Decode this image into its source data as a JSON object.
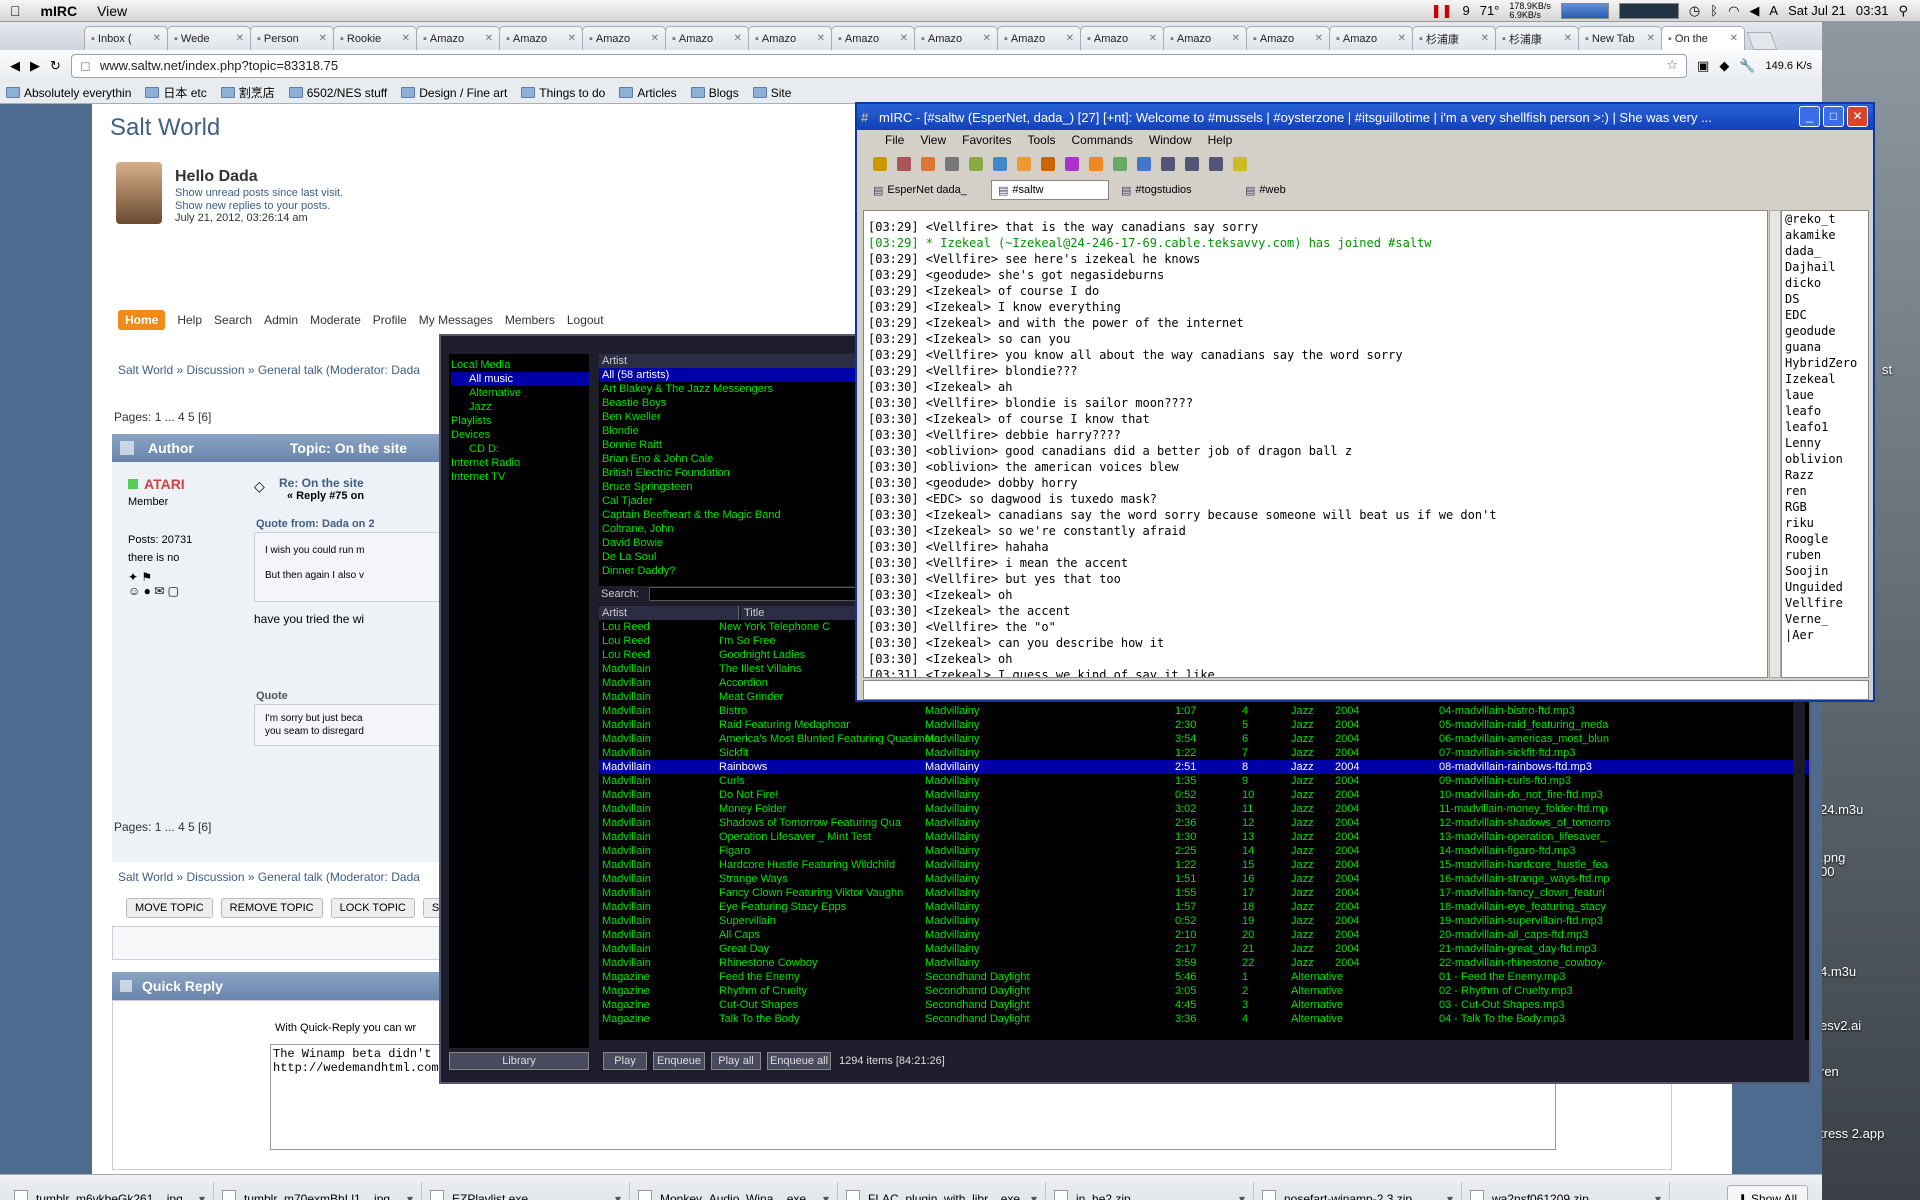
{
  "menubar": {
    "app": "mIRC",
    "menu": "View",
    "temp": "9",
    "pct": "71°",
    "net_up": "178.9KB/s",
    "net_down": "6.9KB/s",
    "date": "Sat Jul 21",
    "time": "03:31"
  },
  "browser": {
    "tabs": [
      "Inbox (",
      "Wede",
      "Person",
      "Rookie",
      "Amazo",
      "Amazo",
      "Amazo",
      "Amazo",
      "Amazo",
      "Amazo",
      "Amazo",
      "Amazo",
      "Amazo",
      "Amazo",
      "Amazo",
      "Amazo",
      "杉浦康",
      "杉浦康",
      "New Tab",
      "On the"
    ],
    "url": "www.saltw.net/index.php?topic=83318.75",
    "speed": "149.6 K/s",
    "bookmarks": [
      "Absolutely everythin",
      "日本 etc",
      "割烹店",
      "6502/NES stuff",
      "Design / Fine art",
      "Things to do",
      "Articles",
      "Blogs",
      "Site"
    ]
  },
  "forum": {
    "title": "Salt World",
    "hello": "Hello Dada",
    "unread": "Show unread posts since last visit.",
    "replies": "Show new replies to your posts.",
    "last_visit": "July 21, 2012, 03:26:14 am",
    "nav": [
      "Home",
      "Help",
      "Search",
      "Admin",
      "Moderate",
      "Profile",
      "My Messages",
      "Members",
      "Logout"
    ],
    "breadcrumb": "Salt World » Discussion » General talk (Moderator: Dada",
    "pages": "Pages: 1 ... 4 5 [6]",
    "author_hdr": "Author",
    "topic_hdr": "Topic: On the site",
    "poster": "ATARI",
    "member": "Member",
    "posts": "Posts: 20731",
    "sig": "there is no",
    "post_title": "Re: On the site",
    "reply_no": "« Reply #75 on",
    "quote_from": "Quote from: Dada on 2",
    "quote1a": "I wish you could run m",
    "quote1b": "But then again I also v",
    "body1": "have you tried the wi",
    "quote_label": "Quote",
    "quote2a": "I'm sorry but just beca",
    "quote2b": "you seam to disregard",
    "pages2": "Pages: 1 ... 4 5 [6]",
    "breadcrumb2": "Salt World » Discussion » General talk (Moderator: Dada",
    "actions": [
      "MOVE TOPIC",
      "REMOVE TOPIC",
      "LOCK TOPIC",
      "SE"
    ],
    "quick_reply": "Quick Reply",
    "qr_note": "With Quick-Reply you can wr",
    "reply_line1": "The Winamp beta didn't rea",
    "reply_line2": "http://wedemandhtml.com/"
  },
  "winamp": {
    "tree": [
      "Local Media",
      "All music",
      "Alternative",
      "Jazz",
      "Playlists",
      "Devices",
      "CD D:",
      "Internet Radio",
      "Internet TV"
    ],
    "artist_hdr": "Artist",
    "artists": [
      "All (58 artists)",
      "Art Blakey & The Jazz Messengers",
      "Beastie Boys",
      "Ben Kweller",
      "Blondie",
      "Bonnie Raitt",
      "Brian Eno & John Cale",
      "British Electric Foundation",
      "Bruce Springsteen",
      "Cal Tjader",
      "Captain Beefheart & the Magic Band",
      "Coltrane, John",
      "David Bowie",
      "De La Soul",
      "Dinner Daddy?"
    ],
    "search_label": "Search:",
    "col_artist": "Artist",
    "col_title": "Title",
    "tracks": [
      [
        "Lou Reed",
        "New York Telephone C",
        "",
        "",
        "",
        "",
        "",
        ""
      ],
      [
        "Lou Reed",
        "I'm So Free",
        "",
        "",
        "",
        "",
        "",
        ""
      ],
      [
        "Lou Reed",
        "Goodnight Ladies",
        "",
        "",
        "",
        "",
        "",
        ""
      ],
      [
        "Madvillain",
        "The Illest Villains",
        "",
        "",
        "",
        "",
        "",
        ""
      ],
      [
        "Madvillain",
        "Accordion",
        "",
        "",
        "",
        "",
        "",
        ""
      ],
      [
        "Madvillain",
        "Meat Grinder",
        "",
        "",
        "",
        "",
        "",
        ""
      ],
      [
        "Madvillain",
        "Bistro",
        "Madvillainy",
        "1:07",
        "4",
        "Jazz",
        "2004",
        "04-madvillain-bistro-ftd.mp3"
      ],
      [
        "Madvillain",
        "Raid Featuring Medaphoar",
        "Madvillainy",
        "2:30",
        "5",
        "Jazz",
        "2004",
        "05-madvillain-raid_featuring_meda"
      ],
      [
        "Madvillain",
        "America's Most Blunted Featuring Quasimoto",
        "Madvillainy",
        "3:54",
        "6",
        "Jazz",
        "2004",
        "06-madvillain-americas_most_blun"
      ],
      [
        "Madvillain",
        "Sickfit",
        "Madvillainy",
        "1:22",
        "7",
        "Jazz",
        "2004",
        "07-madvillain-sickfit-ftd.mp3"
      ],
      [
        "Madvillain",
        "Rainbows",
        "Madvillainy",
        "2:51",
        "8",
        "Jazz",
        "2004",
        "08-madvillain-rainbows-ftd.mp3"
      ],
      [
        "Madvillain",
        "Curls",
        "Madvillainy",
        "1:35",
        "9",
        "Jazz",
        "2004",
        "09-madvillain-curls-ftd.mp3"
      ],
      [
        "Madvillain",
        "Do Not Fire!",
        "Madvillainy",
        "0:52",
        "10",
        "Jazz",
        "2004",
        "10-madvillain-do_not_fire-ftd.mp3"
      ],
      [
        "Madvillain",
        "Money Folder",
        "Madvillainy",
        "3:02",
        "11",
        "Jazz",
        "2004",
        "11-madvillain-money_folder-ftd.mp"
      ],
      [
        "Madvillain",
        "Shadows of Tomorrow Featuring Qua",
        "Madvillainy",
        "2:36",
        "12",
        "Jazz",
        "2004",
        "12-madvillain-shadows_of_tomorro"
      ],
      [
        "Madvillain",
        "Operation Lifesaver _ Mint Test",
        "Madvillainy",
        "1:30",
        "13",
        "Jazz",
        "2004",
        "13-madvillain-operation_lifesaver_"
      ],
      [
        "Madvillain",
        "Figaro",
        "Madvillainy",
        "2:25",
        "14",
        "Jazz",
        "2004",
        "14-madvillain-figaro-ftd.mp3"
      ],
      [
        "Madvillain",
        "Hardcore Hustle Featuring Wildchild",
        "Madvillainy",
        "1:22",
        "15",
        "Jazz",
        "2004",
        "15-madvillain-hardcore_hustle_fea"
      ],
      [
        "Madvillain",
        "Strange Ways",
        "Madvillainy",
        "1:51",
        "16",
        "Jazz",
        "2004",
        "16-madvillain-strange_ways-ftd.mp"
      ],
      [
        "Madvillain",
        "Fancy Clown Featuring Viktor Vaughn",
        "Madvillainy",
        "1:55",
        "17",
        "Jazz",
        "2004",
        "17-madvillain-fancy_clown_featuri"
      ],
      [
        "Madvillain",
        "Eye Featuring Stacy Epps",
        "Madvillainy",
        "1:57",
        "18",
        "Jazz",
        "2004",
        "18-madvillain-eye_featuring_stacy"
      ],
      [
        "Madvillain",
        "Supervillain",
        "Madvillainy",
        "0:52",
        "19",
        "Jazz",
        "2004",
        "19-madvillain-supervillain-ftd.mp3"
      ],
      [
        "Madvillain",
        "All Caps",
        "Madvillainy",
        "2:10",
        "20",
        "Jazz",
        "2004",
        "20-madvillain-all_caps-ftd.mp3"
      ],
      [
        "Madvillain",
        "Great Day",
        "Madvillainy",
        "2:17",
        "21",
        "Jazz",
        "2004",
        "21-madvillain-great_day-ftd.mp3"
      ],
      [
        "Madvillain",
        "Rhinestone Cowboy",
        "Madvillainy",
        "3:59",
        "22",
        "Jazz",
        "2004",
        "22-madvillain-rhinestone_cowboy-"
      ],
      [
        "Magazine",
        "Feed the Enemy",
        "Secondhand Daylight",
        "5:46",
        "1",
        "Alternative",
        "",
        "01 - Feed the Enemy.mp3"
      ],
      [
        "Magazine",
        "Rhythm of Cruelty",
        "Secondhand Daylight",
        "3:05",
        "2",
        "Alternative",
        "",
        "02 - Rhythm of Cruelty.mp3"
      ],
      [
        "Magazine",
        "Cut-Out Shapes",
        "Secondhand Daylight",
        "4:45",
        "3",
        "Alternative",
        "",
        "03 - Cut-Out Shapes.mp3"
      ],
      [
        "Magazine",
        "Talk To the Body",
        "Secondhand Daylight",
        "3:36",
        "4",
        "Alternative",
        "",
        "04 - Talk To the Body.mp3"
      ]
    ],
    "selected_index": 10,
    "library_btn": "Library",
    "buttons": [
      "Play",
      "Enqueue",
      "Play all",
      "Enqueue all"
    ],
    "status": "1294 items [84:21:26]"
  },
  "mirc": {
    "title": "mIRC - [#saltw (EsperNet, dada_) [27] [+nt]: Welcome to #mussels | #oysterzone | #itsguillotime | i'm a very shellfish person >:) | She was very ...",
    "menu": [
      "File",
      "View",
      "Favorites",
      "Tools",
      "Commands",
      "Window",
      "Help"
    ],
    "switchbar": [
      "EsperNet dada_",
      "#saltw",
      "#togstudios",
      "#web"
    ],
    "lines": [
      {
        "t": "[03:29]",
        "n": "<Vellfire>",
        "m": "that is the way canadians say sorry",
        "c": "#000000"
      },
      {
        "t": "[03:29]",
        "n": "* Izekeal",
        "m": "(~Izekeal@24-246-17-69.cable.teksavvy.com) has joined #saltw",
        "c": "#009300"
      },
      {
        "t": "[03:29]",
        "n": "<Vellfire>",
        "m": "see here's izekeal he knows",
        "c": "#000000"
      },
      {
        "t": "[03:29]",
        "n": "<geodude>",
        "m": "she's got negasideburns",
        "c": "#000000"
      },
      {
        "t": "[03:29]",
        "n": "<Izekeal>",
        "m": "of course I do",
        "c": "#000000"
      },
      {
        "t": "[03:29]",
        "n": "<Izekeal>",
        "m": "I know everything",
        "c": "#000000"
      },
      {
        "t": "[03:29]",
        "n": "<Izekeal>",
        "m": "and with the power of the internet",
        "c": "#000000"
      },
      {
        "t": "[03:29]",
        "n": "<Izekeal>",
        "m": "so can you",
        "c": "#000000"
      },
      {
        "t": "[03:29]",
        "n": "<Vellfire>",
        "m": "you know all about the way canadians say the word sorry",
        "c": "#000000"
      },
      {
        "t": "[03:29]",
        "n": "<Vellfire>",
        "m": "blondie???",
        "c": "#000000"
      },
      {
        "t": "[03:30]",
        "n": "<Izekeal>",
        "m": "ah",
        "c": "#000000"
      },
      {
        "t": "[03:30]",
        "n": "<Vellfire>",
        "m": "blondie is sailor moon????",
        "c": "#000000"
      },
      {
        "t": "[03:30]",
        "n": "<Izekeal>",
        "m": "of course I know that",
        "c": "#000000"
      },
      {
        "t": "[03:30]",
        "n": "<Vellfire>",
        "m": "debbie harry????",
        "c": "#000000"
      },
      {
        "t": "[03:30]",
        "n": "<oblivion>",
        "m": "good canadians did a better job of dragon ball z",
        "c": "#000000"
      },
      {
        "t": "[03:30]",
        "n": "<oblivion>",
        "m": "the american voices blew",
        "c": "#000000"
      },
      {
        "t": "[03:30]",
        "n": "<geodude>",
        "m": "dobby horry",
        "c": "#000000"
      },
      {
        "t": "[03:30]",
        "n": "<EDC>",
        "m": "so dagwood is tuxedo mask?",
        "c": "#000000"
      },
      {
        "t": "[03:30]",
        "n": "<Izekeal>",
        "m": "canadians say the word sorry because someone will beat us if we don't",
        "c": "#000000"
      },
      {
        "t": "[03:30]",
        "n": "<Izekeal>",
        "m": "so we're constantly afraid",
        "c": "#000000"
      },
      {
        "t": "[03:30]",
        "n": "<Vellfire>",
        "m": "hahaha",
        "c": "#000000"
      },
      {
        "t": "[03:30]",
        "n": "<Vellfire>",
        "m": "i mean the accent",
        "c": "#000000"
      },
      {
        "t": "[03:30]",
        "n": "<Vellfire>",
        "m": "but yes that too",
        "c": "#000000"
      },
      {
        "t": "[03:30]",
        "n": "<Izekeal>",
        "m": "oh",
        "c": "#000000"
      },
      {
        "t": "[03:30]",
        "n": "<Izekeal>",
        "m": "the accent",
        "c": "#000000"
      },
      {
        "t": "[03:30]",
        "n": "<Vellfire>",
        "m": "the \"o\"",
        "c": "#000000"
      },
      {
        "t": "[03:30]",
        "n": "<Izekeal>",
        "m": "can you describe how it",
        "c": "#000000"
      },
      {
        "t": "[03:30]",
        "n": "<Izekeal>",
        "m": "oh",
        "c": "#000000"
      },
      {
        "t": "[03:31]",
        "n": "<Izekeal>",
        "m": "I guess we kind of say it like",
        "c": "#000000"
      }
    ],
    "nicks": [
      "@reko_t",
      "akamike",
      "dada_",
      "Dajhail",
      "dicko",
      "DS",
      "EDC",
      "geodude",
      "guana",
      "HybridZero",
      "Izekeal",
      "laue",
      "leafo",
      "leafo1",
      "Lenny",
      "oblivion",
      "Razz",
      "ren",
      "RGB",
      "riku",
      "Roogle",
      "ruben",
      "Soojin",
      "Unguided",
      "Vellfire",
      "Verne_",
      "|Aer"
    ]
  },
  "desktop": {
    "items": [
      "st",
      "24.m3u",
      ".png",
      "00",
      "4.m3u",
      "esv2.ai",
      "ren",
      "tress 2.app"
    ]
  },
  "downloads": {
    "files": [
      "tumblr_m6vkbeGk261....jpg",
      "tumblr_m70exmBhLl1....jpg",
      "EZPlaylist.exe",
      "Monkey_Audio_Wina....exe",
      "FLAC_plugin_with_libr....exe",
      "in_he2.zip",
      "nosefart-winamp-2.3.zip",
      "wa2nsf061209.zip"
    ],
    "show_all": "Show All"
  }
}
